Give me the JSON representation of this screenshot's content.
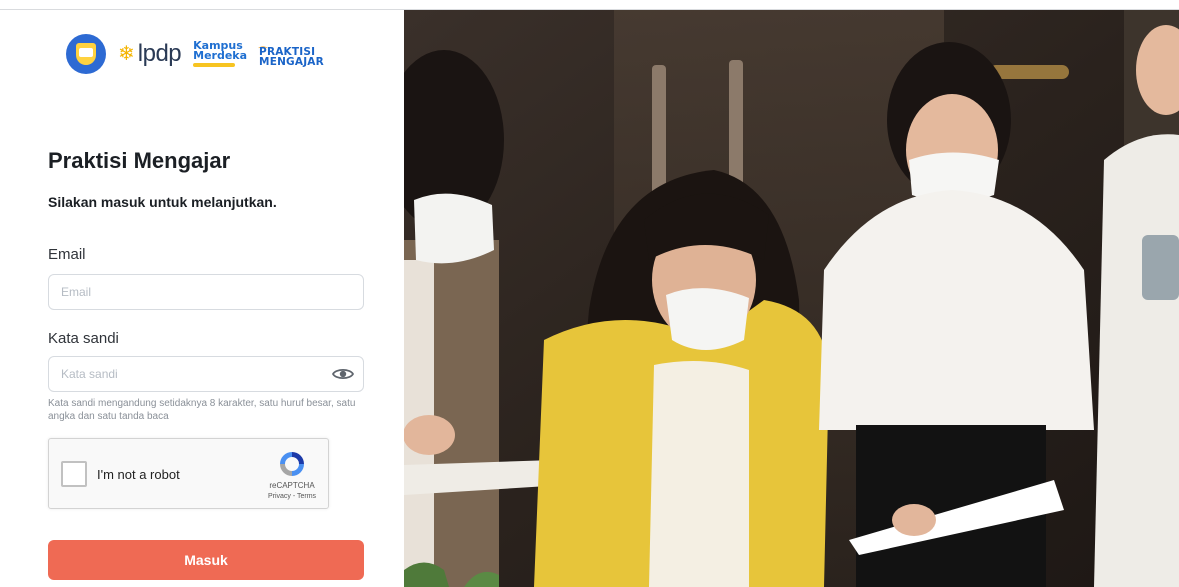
{
  "logos": {
    "lpdp": "lpdp",
    "kampus": [
      "Kampus",
      "Merdeka"
    ],
    "praktisi": [
      "PRAKTISI",
      "MENGAJAR"
    ]
  },
  "header": {
    "title": "Praktisi Mengajar",
    "subtitle": "Silakan masuk untuk melanjutkan."
  },
  "form": {
    "email_label": "Email",
    "email_placeholder": "Email",
    "email_value": "",
    "password_label": "Kata sandi",
    "password_placeholder": "Kata sandi",
    "password_value": "",
    "password_hint": "Kata sandi mengandung setidaknya 8 karakter, satu huruf besar, satu angka dan satu tanda baca",
    "submit_label": "Masuk"
  },
  "recaptcha": {
    "label": "I'm not a robot",
    "brand": "reCAPTCHA",
    "terms": "Privacy - Terms"
  },
  "colors": {
    "accent": "#ef6a54",
    "brand_blue": "#1f6fd1"
  },
  "icons": {
    "password_toggle": "eye-icon",
    "recaptcha": "recaptcha-logo-icon"
  }
}
